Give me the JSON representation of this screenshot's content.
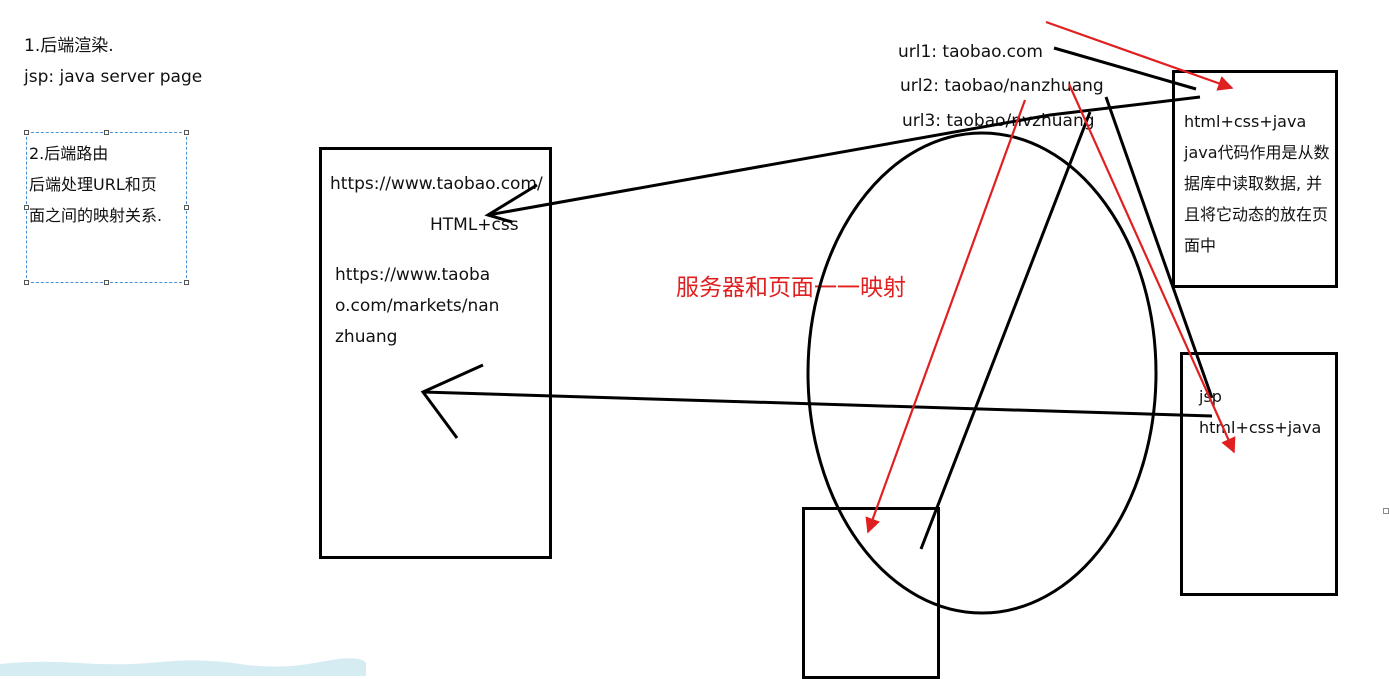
{
  "notes": {
    "item1_title": "1.后端渲染.",
    "item1_jsp": "jsp: java server page",
    "item2_title": "2.后端路由",
    "item2_line1": "后端处理URL和页",
    "item2_line2": "面之间的映射关系."
  },
  "urls": {
    "url1": "url1: taobao.com",
    "url2": "url2: taobao/nanzhuang",
    "url3": "url3: taobao/nvzhuang"
  },
  "page_box": {
    "url_line": "https://www.taobao.com/",
    "html_css": "HTML+css",
    "url2_line1": "https://www.taoba",
    "url2_line2": "o.com/markets/nan",
    "url2_line3": "zhuang"
  },
  "server_box_top": {
    "line1": "html+css+java",
    "line2": "java代码作用是从数",
    "line3": "据库中读取数据, 并",
    "line4": "且将它动态的放在页",
    "line5": "面中"
  },
  "server_box_bottom": {
    "line1": "jsp",
    "line2": "html+css+java"
  },
  "annotation": "服务器和页面一一映射",
  "colors": {
    "ink": "#000000",
    "accent": "#e02020",
    "selection": "#4a90d9"
  }
}
